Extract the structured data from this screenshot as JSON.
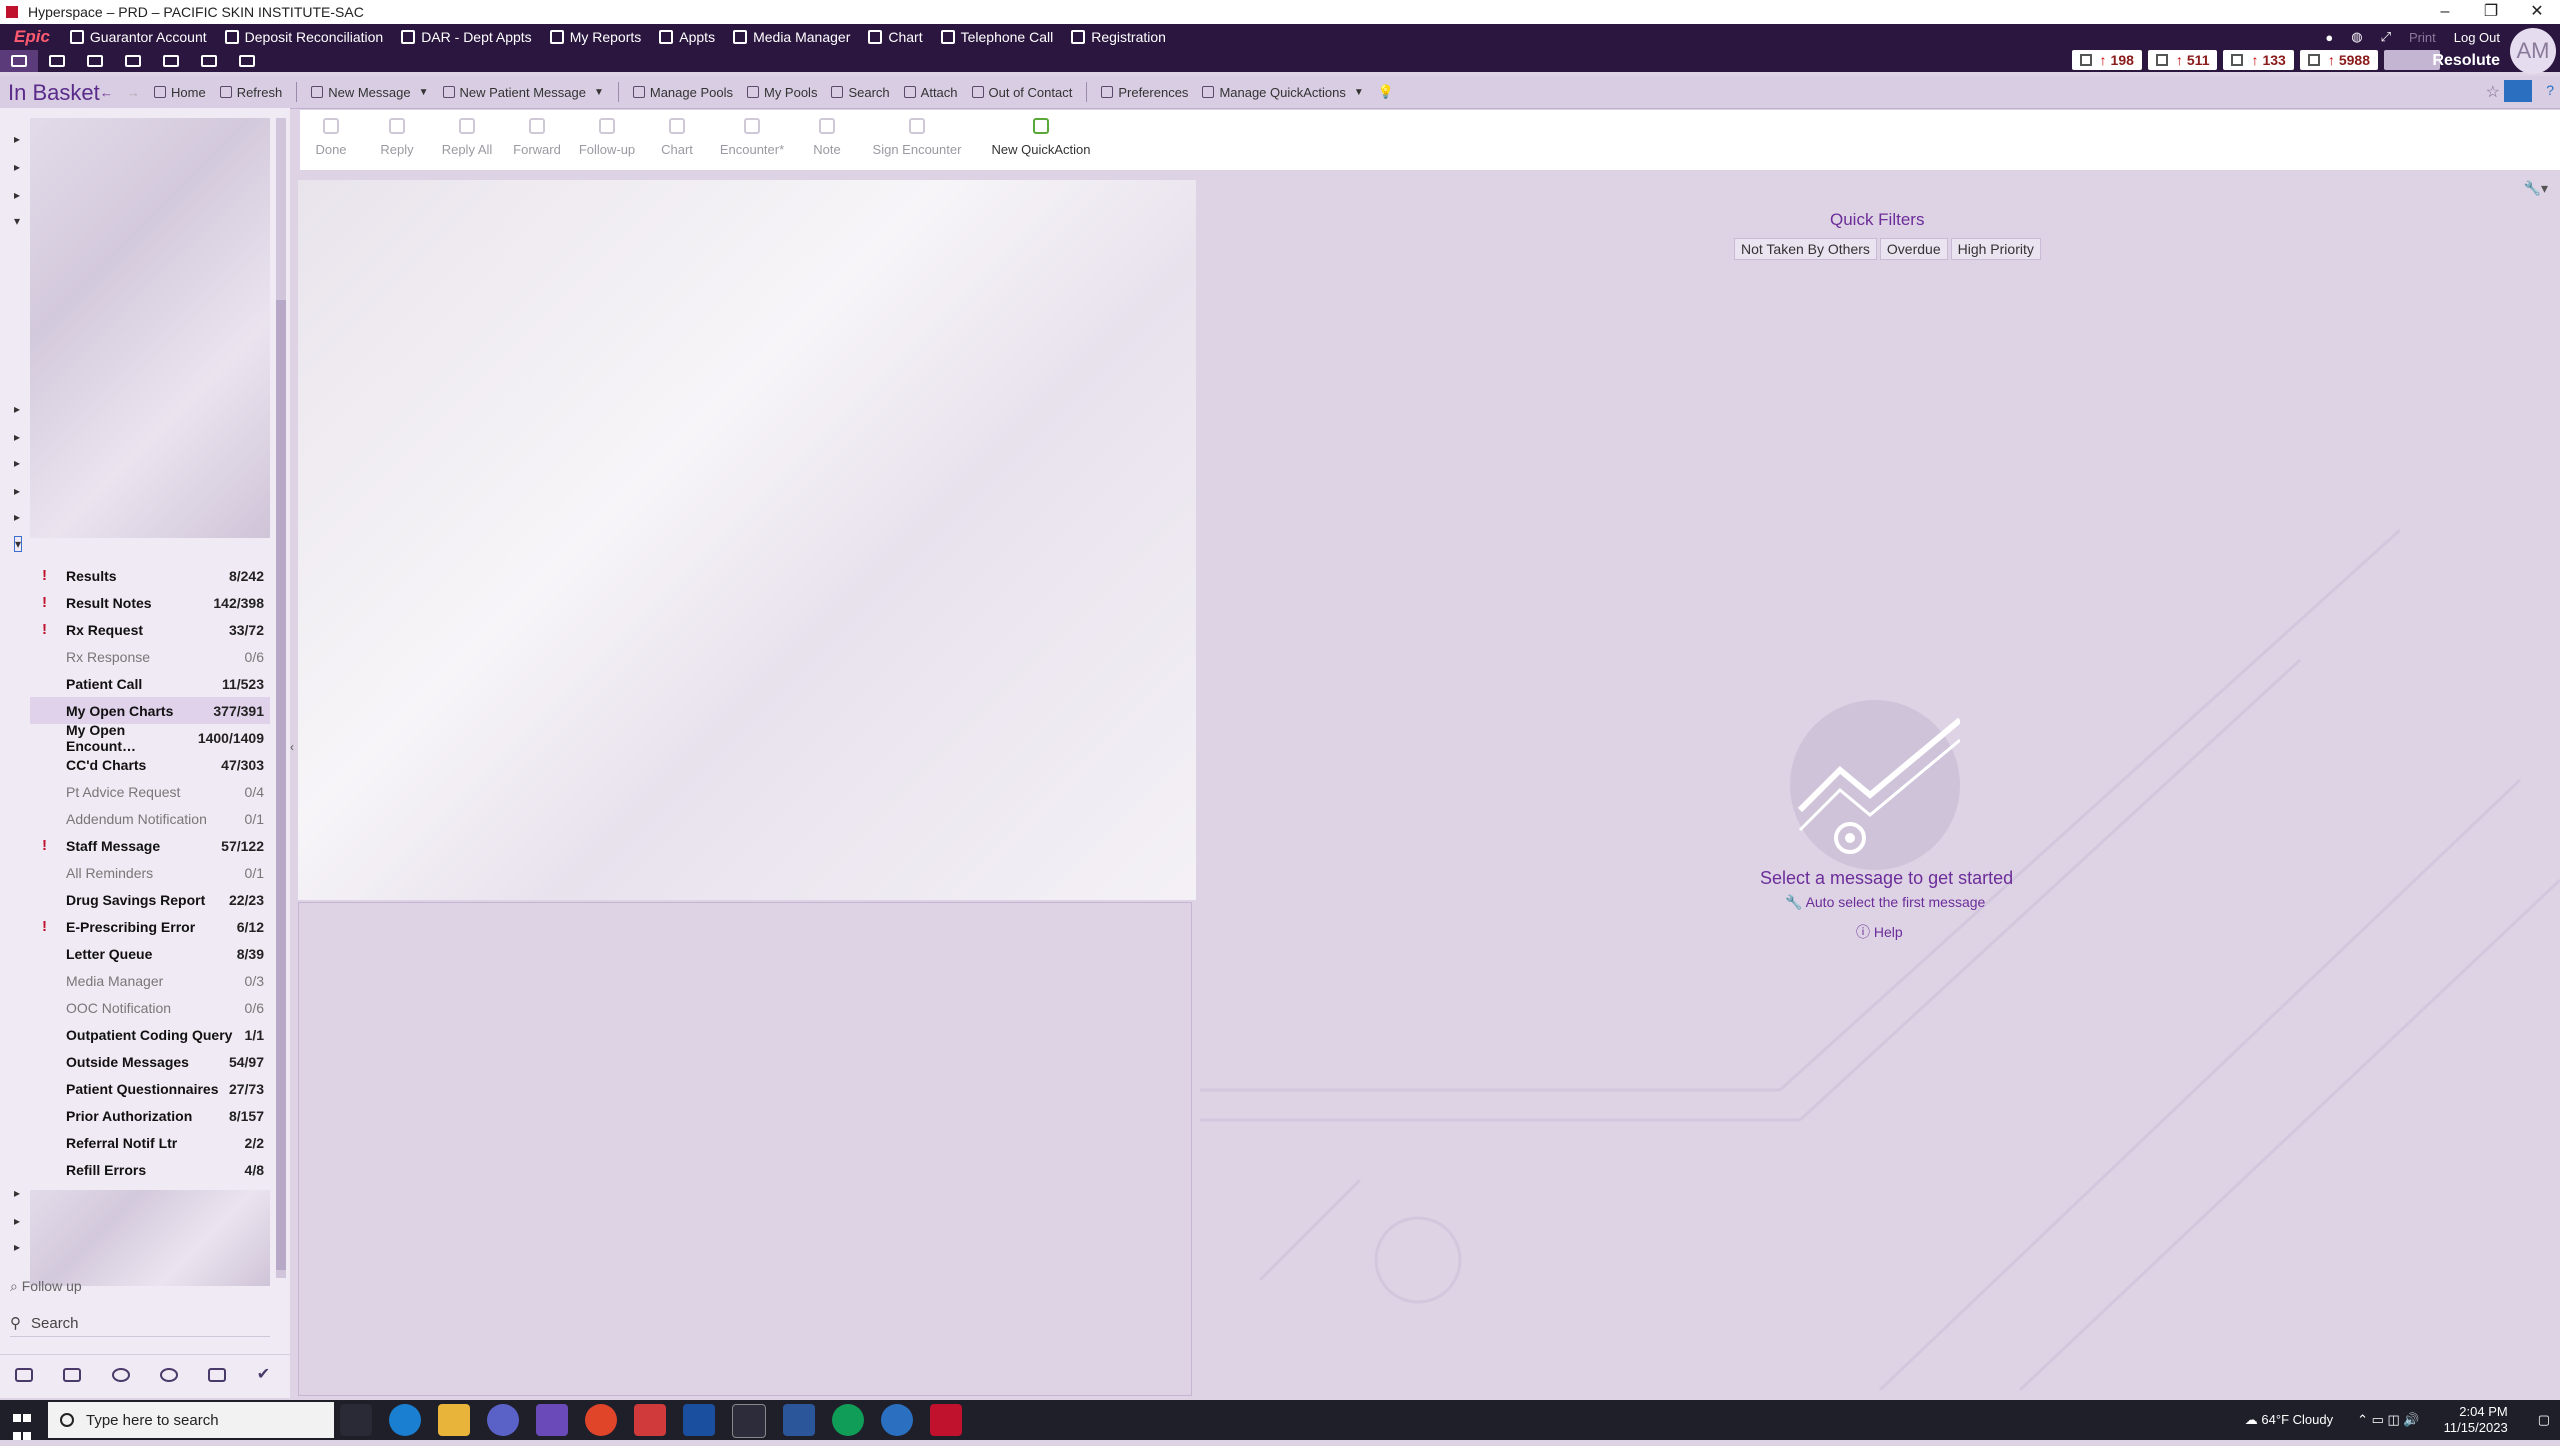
{
  "window": {
    "title": "Hyperspace – PRD – PACIFIC SKIN INSTITUTE-SAC"
  },
  "epic_logo": "Epic",
  "activities": [
    {
      "label": "Guarantor Account",
      "icon": "person-icon"
    },
    {
      "label": "Deposit Reconciliation",
      "icon": "deposit-icon"
    },
    {
      "label": "DAR - Dept Appts",
      "icon": "clipboard-icon"
    },
    {
      "label": "My Reports",
      "icon": "report-icon"
    },
    {
      "label": "Appts",
      "icon": "group-icon"
    },
    {
      "label": "Media Manager",
      "icon": "media-icon"
    },
    {
      "label": "Chart",
      "icon": "folder-icon"
    },
    {
      "label": "Telephone Call",
      "icon": "phone-icon"
    },
    {
      "label": "Registration",
      "icon": "registration-icon"
    }
  ],
  "top_right": {
    "print_label": "Print",
    "logout_label": "Log Out",
    "resolute_label": "Resolute",
    "avatar_initials": "AM"
  },
  "counters": [
    {
      "value": "198",
      "icon": "person-alert-icon"
    },
    {
      "value": "511",
      "icon": "chart-alert-icon"
    },
    {
      "value": "133",
      "icon": "cart-icon"
    },
    {
      "value": "5988",
      "icon": "inbox-icon"
    }
  ],
  "activity_title": "In Basket",
  "menubar": {
    "home": "Home",
    "refresh": "Refresh",
    "new_message": "New Message",
    "new_patient_message": "New Patient Message",
    "manage_pools": "Manage Pools",
    "my_pools": "My Pools",
    "search": "Search",
    "attach": "Attach",
    "out_of_contact": "Out of Contact",
    "preferences": "Preferences",
    "manage_quickactions": "Manage QuickActions"
  },
  "toolbar": {
    "done": "Done",
    "reply": "Reply",
    "reply_all": "Reply All",
    "forward": "Forward",
    "follow_up": "Follow-up",
    "chart": "Chart",
    "encounter": "Encounter*",
    "note": "Note",
    "sign_encounter": "Sign Encounter",
    "new_quickaction": "New QuickAction"
  },
  "folders": [
    {
      "name": "Results",
      "count": "8/242",
      "priority": true,
      "bold": true
    },
    {
      "name": "Result Notes",
      "count": "142/398",
      "priority": true,
      "bold": true
    },
    {
      "name": "Rx Request",
      "count": "33/72",
      "priority": true,
      "bold": true
    },
    {
      "name": "Rx Response",
      "count": "0/6",
      "priority": false,
      "bold": false
    },
    {
      "name": "Patient Call",
      "count": "11/523",
      "priority": false,
      "bold": true
    },
    {
      "name": "My Open Charts",
      "count": "377/391",
      "priority": false,
      "bold": true,
      "selected": true
    },
    {
      "name": "My Open Encount…",
      "count": "1400/1409",
      "priority": false,
      "bold": true
    },
    {
      "name": "CC'd Charts",
      "count": "47/303",
      "priority": false,
      "bold": true
    },
    {
      "name": "Pt Advice Request",
      "count": "0/4",
      "priority": false,
      "bold": false
    },
    {
      "name": "Addendum Notification",
      "count": "0/1",
      "priority": false,
      "bold": false
    },
    {
      "name": "Staff Message",
      "count": "57/122",
      "priority": true,
      "bold": true
    },
    {
      "name": "All Reminders",
      "count": "0/1",
      "priority": false,
      "bold": false
    },
    {
      "name": "Drug Savings Report",
      "count": "22/23",
      "priority": false,
      "bold": true
    },
    {
      "name": "E-Prescribing Error",
      "count": "6/12",
      "priority": true,
      "bold": true
    },
    {
      "name": "Letter Queue",
      "count": "8/39",
      "priority": false,
      "bold": true
    },
    {
      "name": "Media Manager",
      "count": "0/3",
      "priority": false,
      "bold": false
    },
    {
      "name": "OOC Notification",
      "count": "0/6",
      "priority": false,
      "bold": false
    },
    {
      "name": "Outpatient Coding Query",
      "count": "1/1",
      "priority": false,
      "bold": true
    },
    {
      "name": "Outside Messages",
      "count": "54/97",
      "priority": false,
      "bold": true
    },
    {
      "name": "Patient Questionnaires",
      "count": "27/73",
      "priority": false,
      "bold": true
    },
    {
      "name": "Prior Authorization",
      "count": "8/157",
      "priority": false,
      "bold": true
    },
    {
      "name": "Referral Notif Ltr",
      "count": "2/2",
      "priority": false,
      "bold": true
    },
    {
      "name": "Refill Errors",
      "count": "4/8",
      "priority": false,
      "bold": true
    }
  ],
  "sidebar": {
    "follow_up": "Follow up",
    "search": "Search"
  },
  "quick_filters": {
    "title": "Quick Filters",
    "buttons": [
      "Not Taken By Others",
      "Overdue",
      "High Priority"
    ]
  },
  "empty_state": {
    "title": "Select a message to get started",
    "auto_select": "Auto select the first message",
    "help": "Help"
  },
  "taskbar": {
    "search_placeholder": "Type here to search",
    "weather": "64°F  Cloudy",
    "time": "2:04 PM",
    "date": "11/15/2023"
  },
  "colors": {
    "accent": "#6c2d9a",
    "top_bar": "#2b1640",
    "priority": "#c0122c",
    "background": "#ddd3e4"
  }
}
